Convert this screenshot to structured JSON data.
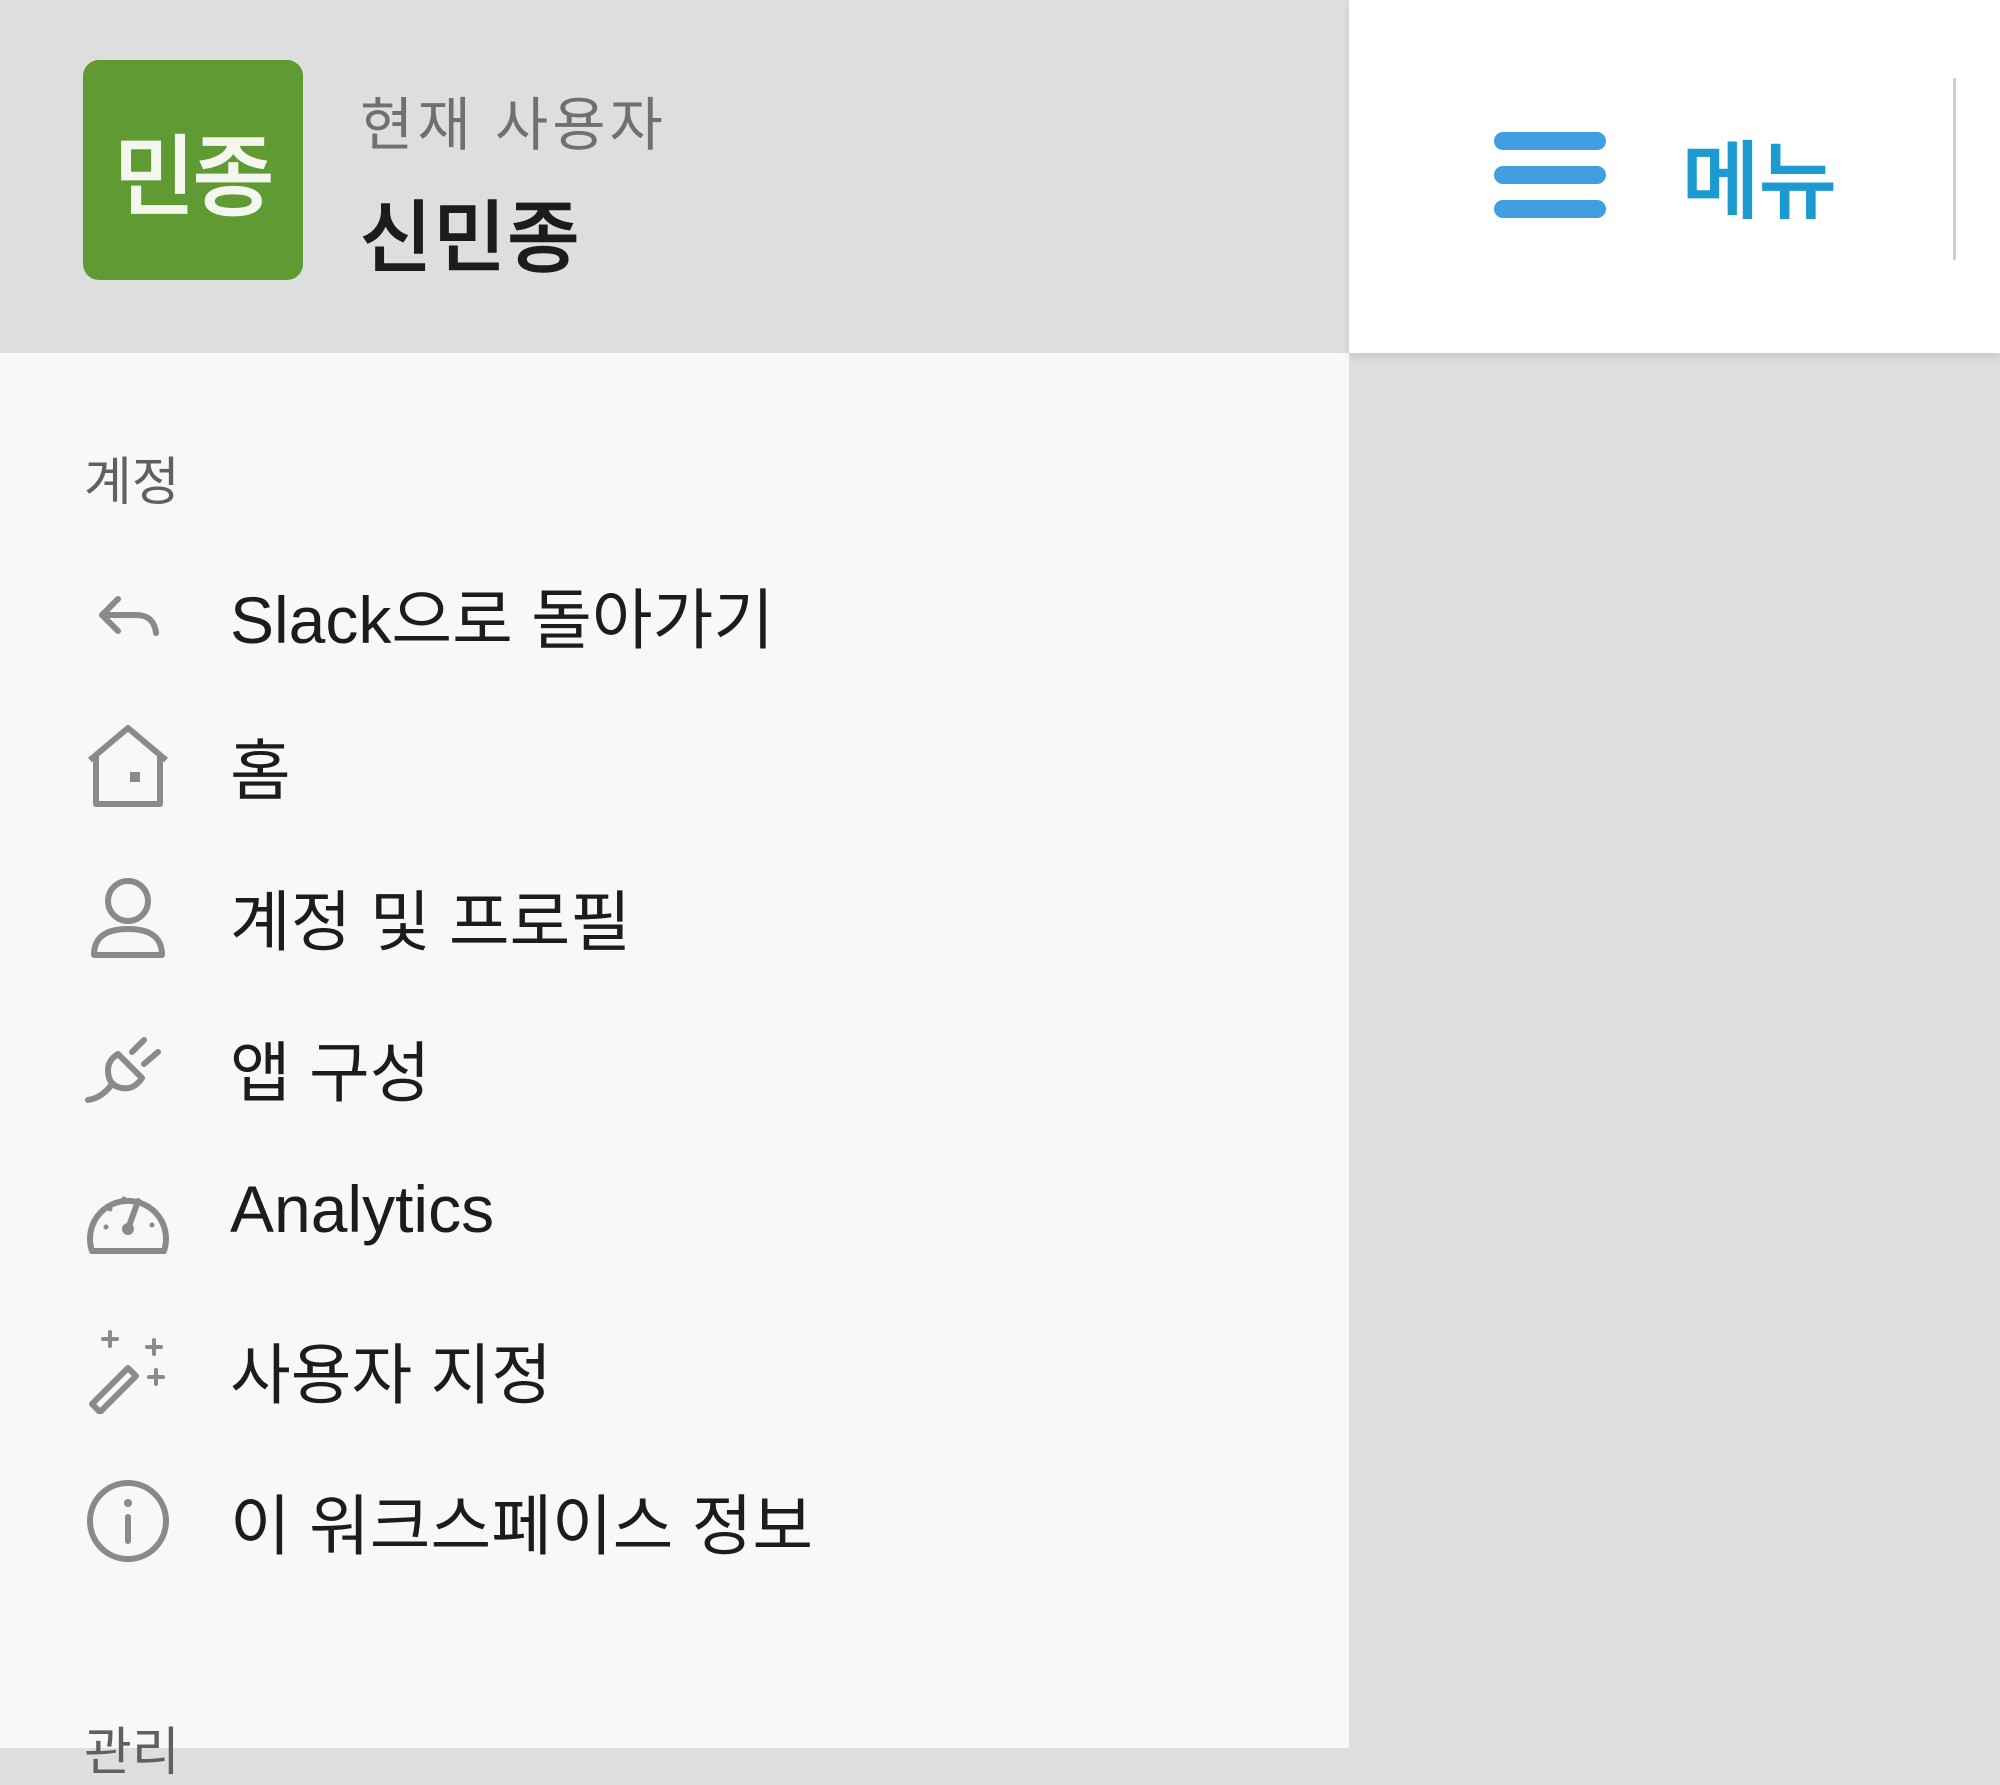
{
  "user": {
    "avatar_text": "민종",
    "caption": "현재 사용자",
    "name": "신민종"
  },
  "topbar": {
    "menu_label": "메뉴"
  },
  "sections": {
    "account_title": "계정",
    "admin_title": "관리"
  },
  "nav": {
    "items": [
      {
        "label": "Slack으로 돌아가기",
        "icon": "reply-arrow-icon"
      },
      {
        "label": "홈",
        "icon": "home-icon"
      },
      {
        "label": "계정 및 프로필",
        "icon": "user-icon"
      },
      {
        "label": "앱 구성",
        "icon": "plug-icon"
      },
      {
        "label": "Analytics",
        "icon": "gauge-icon"
      },
      {
        "label": "사용자 지정",
        "icon": "magic-wand-icon"
      },
      {
        "label": "이 워크스페이스 정보",
        "icon": "info-icon"
      }
    ]
  },
  "colors": {
    "avatar_bg": "#5f9a33",
    "menu_accent": "#1d9bd1",
    "icon_gray": "#8a8a8a"
  }
}
